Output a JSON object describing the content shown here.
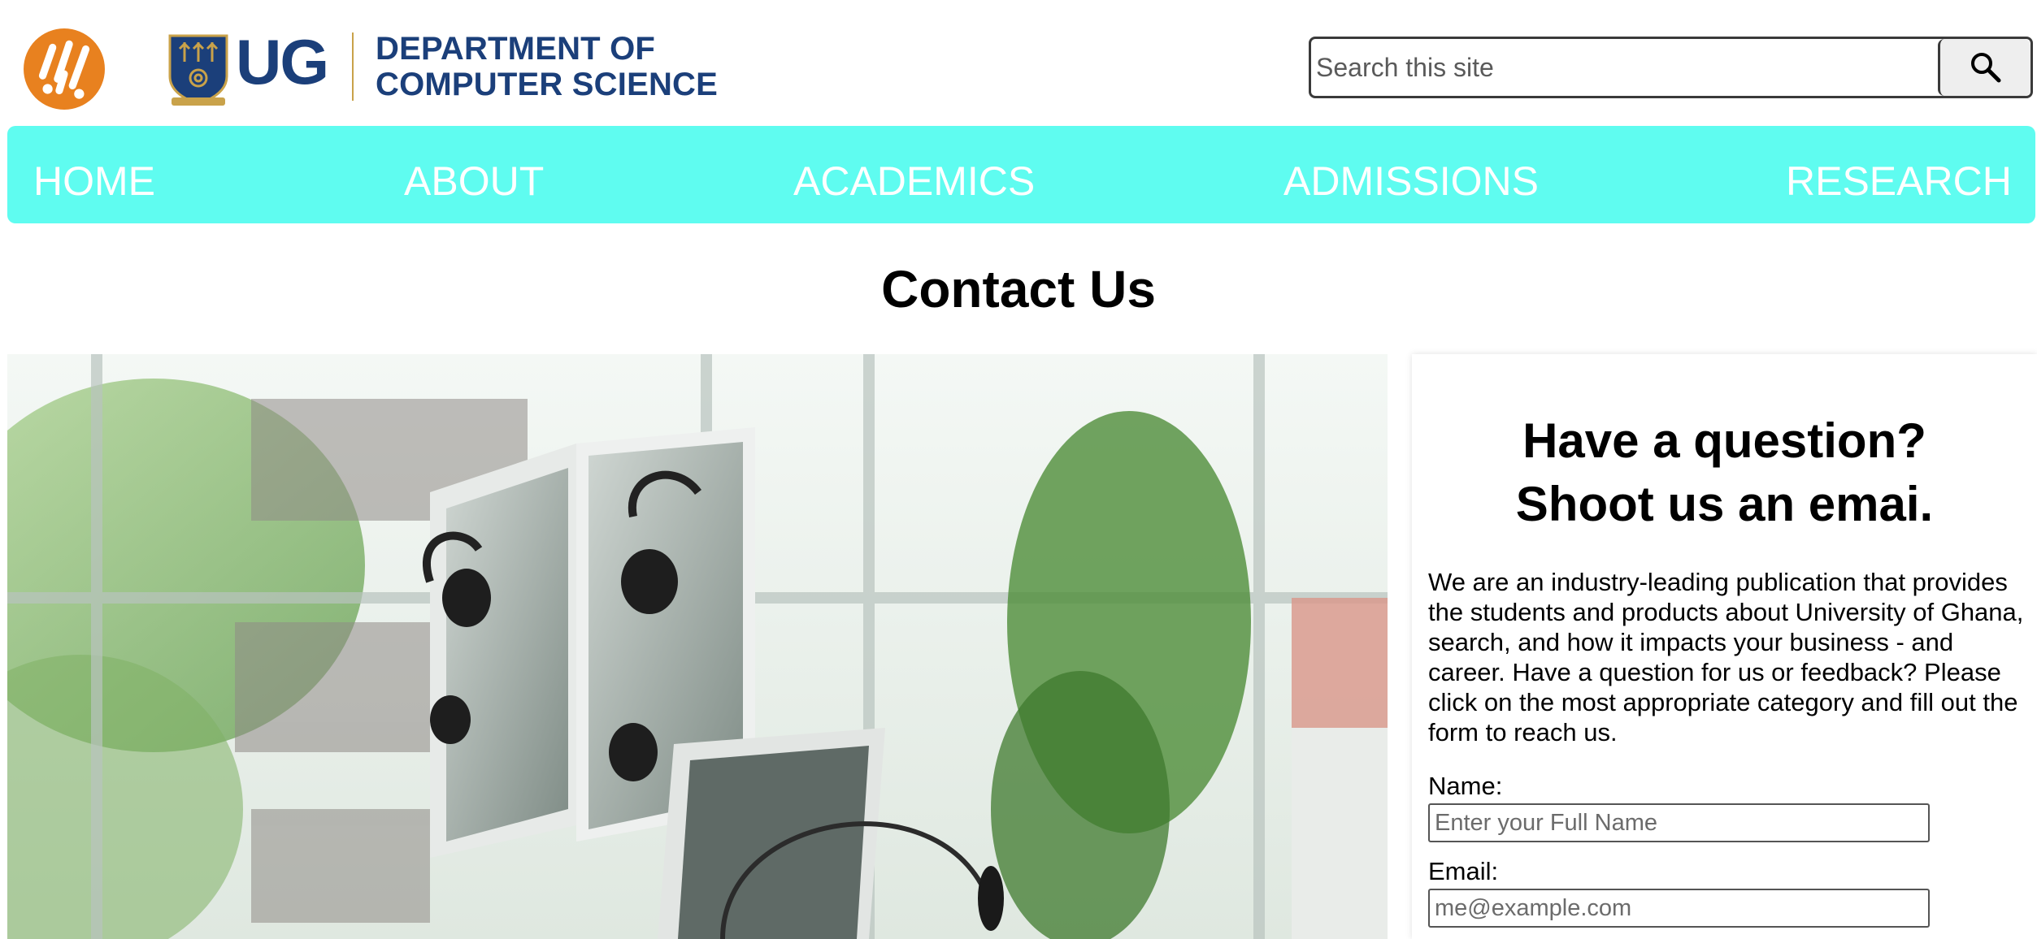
{
  "header": {
    "logo_icon": "orange-circle-logo-icon",
    "crest_icon": "ug-crest-icon",
    "ug_text": "UG",
    "dept_line1": "DEPARTMENT OF",
    "dept_line2": "COMPUTER SCIENCE",
    "brand_color": "#1b3f7a",
    "accent_color": "#e8811f"
  },
  "search": {
    "placeholder": "Search this site",
    "button_icon": "search-icon"
  },
  "nav": {
    "background": "#5ffcf0",
    "items": [
      {
        "label": "HOME"
      },
      {
        "label": "ABOUT"
      },
      {
        "label": "ACADEMICS"
      },
      {
        "label": "ADMISSIONS"
      },
      {
        "label": "RESEARCH"
      }
    ]
  },
  "page": {
    "title": "Contact Us"
  },
  "contact": {
    "heading_line1": "Have a question?",
    "heading_line2": "Shoot us an emai.",
    "intro": "We are an industry-leading publication that provides the students and products about University of Ghana, search, and how it impacts your business - and career. Have a question for us or feedback? Please click on the most appropriate category and fill out the form to reach us.",
    "name_label": "Name:",
    "name_placeholder": "Enter your Full Name",
    "email_label": "Email:",
    "email_placeholder": "me@example.com"
  }
}
